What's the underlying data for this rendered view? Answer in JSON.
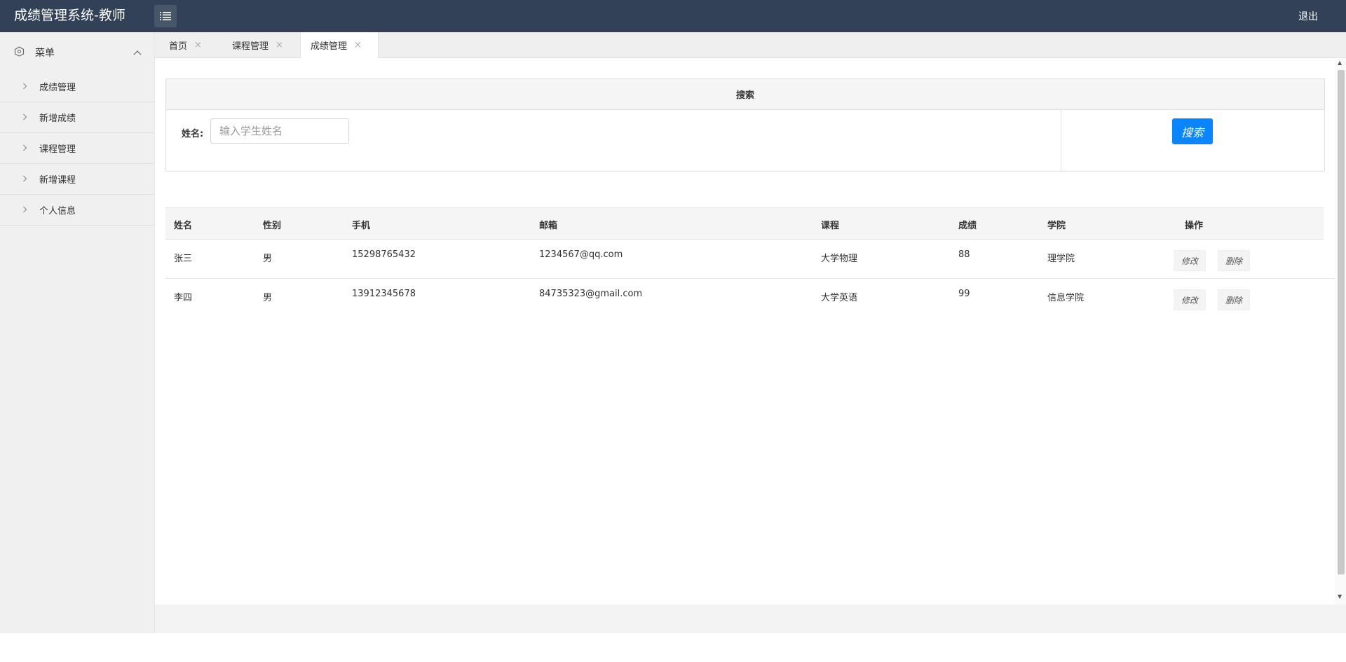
{
  "header": {
    "app_title": "成绩管理系统-教师",
    "logout_label": "退出"
  },
  "sidebar": {
    "menu_label": "菜单",
    "items": [
      {
        "label": "成绩管理"
      },
      {
        "label": "新增成绩"
      },
      {
        "label": "课程管理"
      },
      {
        "label": "新增课程"
      },
      {
        "label": "个人信息"
      }
    ]
  },
  "tabs": [
    {
      "label": "首页",
      "close": "×"
    },
    {
      "label": "课程管理",
      "close": "×"
    },
    {
      "label": "成绩管理",
      "close": "×",
      "active": true
    }
  ],
  "search": {
    "title": "搜索",
    "name_label": "姓名:",
    "name_placeholder": "输入学生姓名",
    "name_value": "",
    "button_label": "搜索"
  },
  "table": {
    "headers": [
      "姓名",
      "性别",
      "手机",
      "邮箱",
      "课程",
      "成绩",
      "学院",
      "操作"
    ],
    "rows": [
      {
        "name": "张三",
        "gender": "男",
        "phone": "15298765432",
        "email": "1234567@qq.com",
        "course": "大学物理",
        "score": "88",
        "college": "理学院",
        "edit": "修改",
        "delete": "删除"
      },
      {
        "name": "李四",
        "gender": "男",
        "phone": "13912345678",
        "email": "84735323@gmail.com",
        "course": "大学英语",
        "score": "99",
        "college": "信息学院",
        "edit": "修改",
        "delete": "删除"
      }
    ]
  },
  "colors": {
    "topbar": "#324158",
    "primary_button": "#0a84ff"
  }
}
